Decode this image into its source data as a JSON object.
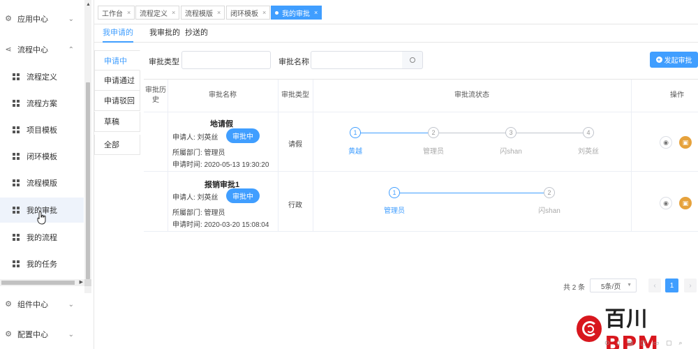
{
  "sidebar": {
    "groups": [
      {
        "label": "应用中心",
        "icon": "gear-icon",
        "state": "collapsed"
      },
      {
        "label": "流程中心",
        "icon": "share-icon",
        "state": "expanded"
      },
      {
        "label": "组件中心",
        "icon": "gear-icon",
        "state": "collapsed"
      },
      {
        "label": "配置中心",
        "icon": "gear-icon",
        "state": "collapsed"
      }
    ],
    "items": [
      {
        "label": "流程定义"
      },
      {
        "label": "流程方案"
      },
      {
        "label": "项目模板"
      },
      {
        "label": "闭环模板"
      },
      {
        "label": "流程模版"
      },
      {
        "label": "我的审批",
        "active": true
      },
      {
        "label": "我的流程"
      },
      {
        "label": "我的任务"
      }
    ]
  },
  "tabs": [
    {
      "label": "工作台"
    },
    {
      "label": "流程定义"
    },
    {
      "label": "流程模版"
    },
    {
      "label": "闭环模板"
    },
    {
      "label": "我的审批",
      "active": true
    }
  ],
  "subtabs": [
    {
      "label": "我申请的",
      "active": true
    },
    {
      "label": "我审批的"
    },
    {
      "label": "抄送的"
    }
  ],
  "status_tabs": [
    {
      "label": "申请中",
      "active": true
    },
    {
      "label": "申请通过"
    },
    {
      "label": "申请驳回"
    },
    {
      "label": "草稿"
    },
    {
      "label": "全部"
    }
  ],
  "filters": {
    "type_label": "审批类型",
    "type_value": "",
    "name_label": "审批名称",
    "name_value": "",
    "start_button": "发起审批"
  },
  "table": {
    "headers": {
      "history": "审批历史",
      "name": "审批名称",
      "type": "审批类型",
      "flow": "审批流状态",
      "actions": "操作"
    },
    "rows": [
      {
        "title": "地请假",
        "applicant": "申请人: 刘英丝",
        "status": "审批中",
        "dept": "所屬部门: 管理员",
        "time": "申请时间: 2020-05-13 19:30:20",
        "type": "请假",
        "steps": [
          {
            "num": "1",
            "name": "黄越",
            "active": true
          },
          {
            "num": "2",
            "name": "管理员"
          },
          {
            "num": "3",
            "name": "闪shan"
          },
          {
            "num": "4",
            "name": "刘英丝"
          }
        ]
      },
      {
        "title": "报销审批1",
        "applicant": "申请人: 刘英丝",
        "status": "审批中",
        "dept": "所屬部门: 管理员",
        "time": "申请时间: 2020-03-20 15:08:04",
        "type": "行政",
        "steps": [
          {
            "num": "1",
            "name": "管理员",
            "active": true
          },
          {
            "num": "2",
            "name": "闪shan"
          }
        ]
      }
    ]
  },
  "pagination": {
    "total": "共 2 条",
    "page_size": "5条/页",
    "current": "1",
    "prev": "‹",
    "next": "›"
  },
  "logo": {
    "text_a": "百川",
    "text_b": "BPM"
  },
  "colors": {
    "primary": "#409eff",
    "warning": "#e6a23c",
    "logo_red": "#d8171e"
  }
}
